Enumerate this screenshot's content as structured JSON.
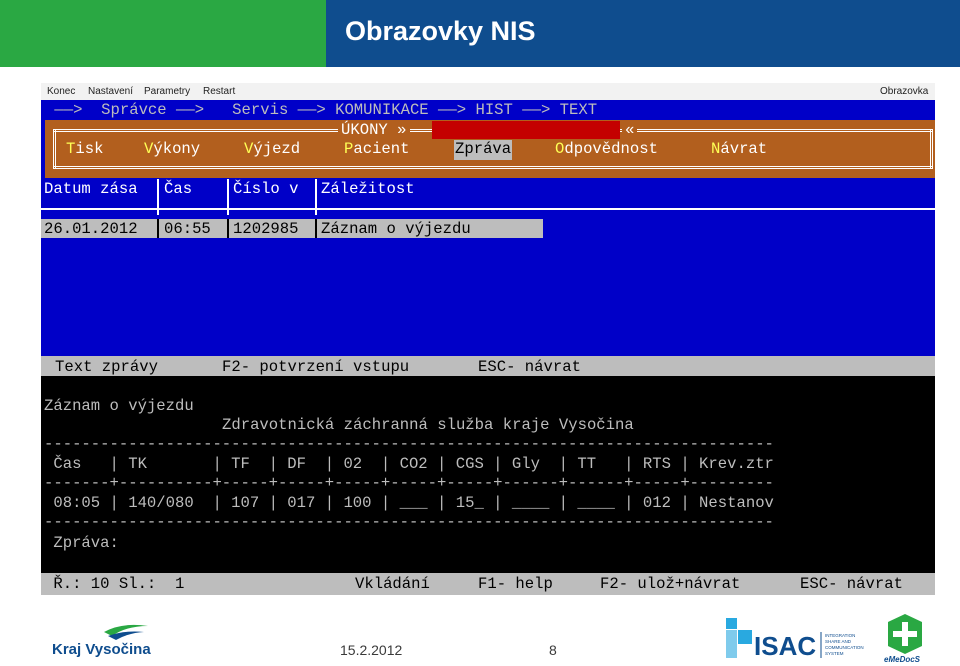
{
  "slide": {
    "title": "Obrazovky NIS",
    "date": "15.2.2012",
    "page": "8"
  },
  "window": {
    "menu": [
      "Konec",
      "Nastavení",
      "Parametry",
      "Restart"
    ],
    "right_label": "Obrazovka"
  },
  "breadcrumb": {
    "text": " ——>  Správce ——>   Servis ——> KOMUNIKACE ——> HIST ——> TEXT"
  },
  "ukony": {
    "label": "ÚKONY »",
    "end": "«",
    "menu": [
      {
        "hotkey": "T",
        "rest": "isk"
      },
      {
        "hotkey": "V",
        "rest": "ýkony"
      },
      {
        "hotkey": "V",
        "rest": "ýjezd"
      },
      {
        "hotkey": "P",
        "rest": "acient"
      },
      {
        "hotkey": "",
        "rest": "Zpráva"
      },
      {
        "hotkey": "O",
        "rest": "dpovědnost"
      },
      {
        "hotkey": "N",
        "rest": "ávrat"
      }
    ]
  },
  "table": {
    "headers": [
      "Datum zása",
      "Čas",
      "Číslo v",
      "Záležitost"
    ],
    "rows": [
      [
        "26.01.2012",
        "06:55",
        "1202985",
        "Záznam o výjezdu"
      ]
    ]
  },
  "status": {
    "label": "Text zprávy",
    "f2": "F2- potvrzení vstupu",
    "esc": "ESC- návrat"
  },
  "message": {
    "title": "Záznam o výjezdu",
    "org": "Zdravotnická záchranná služba kraje Vysočina",
    "dash_line": "------------------------------------------------------------------------------",
    "header_line": " Čas   | TK       | TF  | DF  | 02  | CO2 | CGS | Gly  | TT   | RTS | Krev.ztr",
    "mid_line": "-------+----------+-----+-----+-----+-----+-----+------+------+-----+---------",
    "value_line": " 08:05 | 140/080  | 107 | 017 | 100 | ___ | 15_ | ____ | ____ | 012 | Nestanov",
    "zprava": " Zpráva:"
  },
  "bottom": {
    "pos": " Ř.: 10 Sl.:  1",
    "mode": "Vkládání",
    "f1": "F1- help",
    "f2": "F2- ulož+návrat",
    "esc": "ESC- návrat"
  },
  "logos": {
    "kraj": "Kraj Vysočina",
    "isac": "ISAC",
    "isac_sub": [
      "INTEGRATION",
      "SHARE AND",
      "COMMUNICATION",
      "SYSTEM"
    ],
    "emedocs": "eMeDocS"
  },
  "colors": {
    "header_green": "#2aa843",
    "header_blue": "#0f4d8e",
    "terminal_blue": "#0000c8",
    "band_orange": "#b25f1e",
    "field_red": "#c40000"
  }
}
